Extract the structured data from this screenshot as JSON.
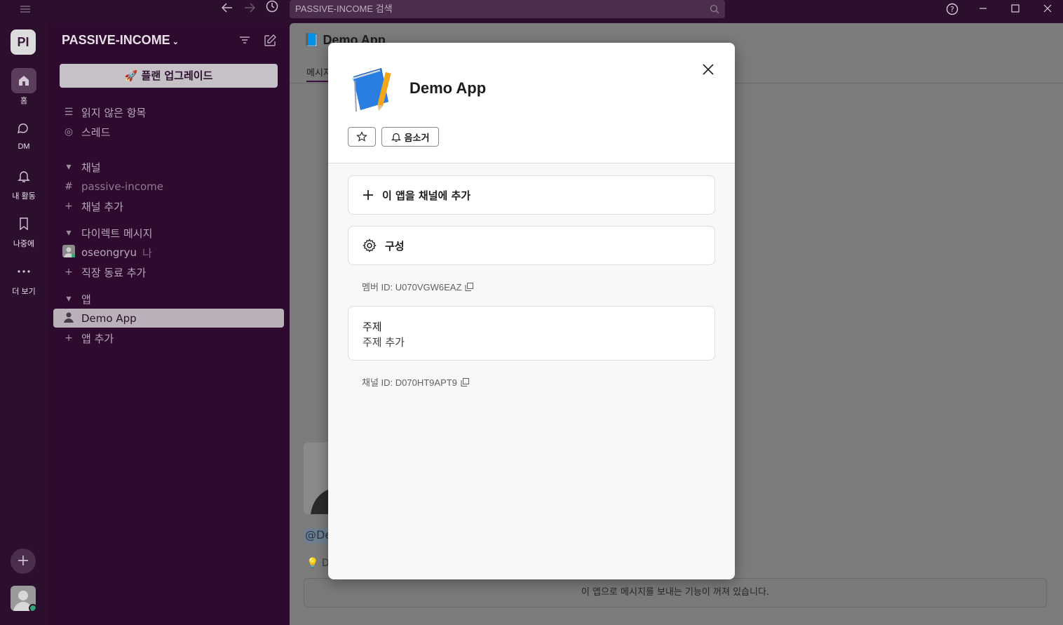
{
  "titlebar": {
    "search_placeholder": "PASSIVE-INCOME 검색",
    "icons": [
      "menu-icon",
      "back-arrow-icon",
      "forward-arrow-icon",
      "history-icon",
      "help-icon",
      "minimize-icon",
      "maximize-icon",
      "close-icon"
    ]
  },
  "rail": {
    "workspace_initials": "PI",
    "items": [
      {
        "label": "홈",
        "icon": "home-icon"
      },
      {
        "label": "DM",
        "icon": "dm-icon"
      },
      {
        "label": "내 활동",
        "icon": "bell-icon"
      },
      {
        "label": "나중에",
        "icon": "bookmark-icon"
      },
      {
        "label": "더 보기",
        "icon": "more-icon"
      }
    ],
    "add_symbol": "+"
  },
  "sidebar": {
    "workspace_name": "PASSIVE-INCOME",
    "upgrade_label": "플랜 업그레이드",
    "unread_label": "읽지 않은 항목",
    "threads_label": "스레드",
    "channels_header": "채널",
    "channel_name": "passive-income",
    "add_channel_label": "채널 추가",
    "dm_header": "다이렉트 메시지",
    "dm_user": "oseongryu",
    "dm_you": "나",
    "add_coworker_label": "직장 동료 추가",
    "apps_header": "앱",
    "app_item": "Demo App",
    "add_app_label": "앱 추가"
  },
  "main": {
    "channel_title": "Demo App",
    "tab_label": "메시지",
    "mention_text": "@De",
    "hint_text": "D",
    "composer_disabled_text": "이 앱으로 메시지를 보내는 기능이 꺼져 있습니다."
  },
  "modal": {
    "app_name": "Demo App",
    "mute_label": "음소거",
    "add_to_channel_label": "이 앱을 채널에 추가",
    "configure_label": "구성",
    "member_id_text": "멤버 ID: U070VGW6EAZ",
    "topic_title": "주제",
    "topic_value": "주제 추가",
    "channel_id_text": "채널 ID: D070HT9APT9"
  },
  "colors": {
    "aubergine": "#3f0e40",
    "titlebar": "#2b0f2c",
    "online_green": "#2bac76"
  }
}
